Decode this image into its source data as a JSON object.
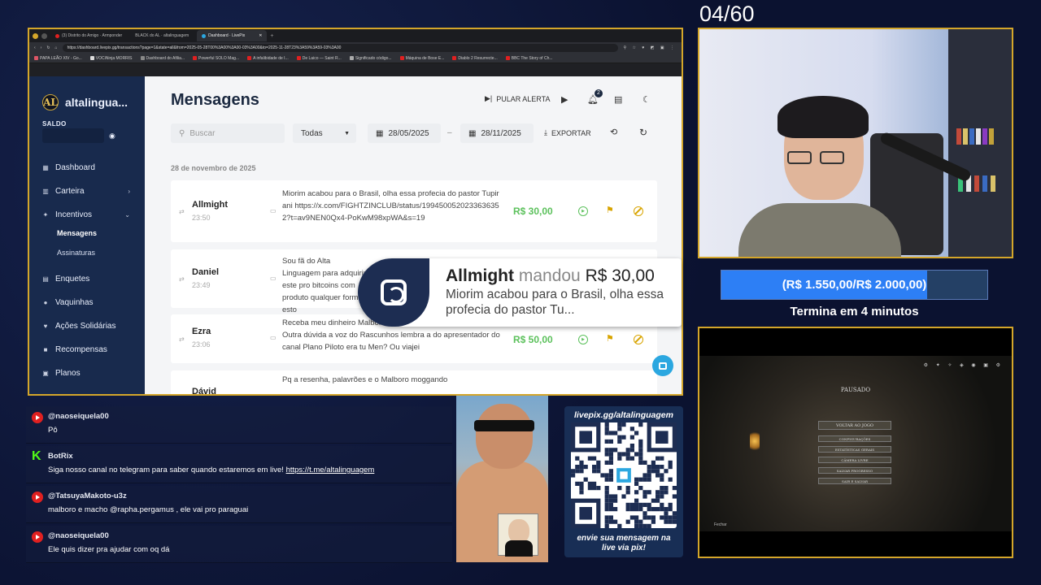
{
  "overlay": {
    "counter": "04/60",
    "goal_text": "(R$ 1.550,00/R$ 2.000,00)",
    "goal_progress": 0.775,
    "goal_ends": "Termina em 4 minutos",
    "qr_title": "livepix.gg/altalinguagem",
    "qr_footer_1": "envie sua mensagem na",
    "qr_footer_2": "live via pix!",
    "colors": {
      "frame": "#d4a62a",
      "goal_fill": "#2d7ff5",
      "bg": "#0b1230"
    }
  },
  "browser": {
    "tabs": [
      "(3) Distrito do Amigo · Armponder",
      "BLACK do AL · altalinguagem",
      "Dashboard · LivePix"
    ],
    "url": "https://dashboard.livepix.gg/transactions?page=1&state=all&from=2025-05-28T00%3A00%3A00-03%3A00&to=2025-11-28T23%3A59%3A59-03%3A00",
    "bookmarks": [
      "PAPA LEÃO XIV - Go...",
      "VOCiNinja MORRIS",
      "Dashboard do Afilia...",
      "Powerful SOLO Mag...",
      "A infalibidade de I...",
      "De Laico — Saint R...",
      "Significado código...",
      "Máquina de Bose E...",
      "Diablo 2 Resurrecte...",
      "BBC The Story of Ch..."
    ]
  },
  "sidebar": {
    "brand": "altalingua...",
    "logo": "AL",
    "saldo_label": "SALDO",
    "items": [
      {
        "label": "Dashboard",
        "icon": "dashboard-icon"
      },
      {
        "label": "Carteira",
        "icon": "wallet-icon"
      },
      {
        "label": "Incentivos",
        "icon": "sparkle-icon"
      },
      {
        "label": "Enquetes",
        "icon": "poll-icon"
      },
      {
        "label": "Vaquinhas",
        "icon": "piggy-icon"
      },
      {
        "label": "Ações Solidárias",
        "icon": "heart-icon"
      },
      {
        "label": "Recompensas",
        "icon": "gift-icon"
      },
      {
        "label": "Planos",
        "icon": "plans-icon"
      }
    ],
    "sub_items": [
      "Mensagens",
      "Assinaturas"
    ]
  },
  "main": {
    "title": "Mensagens",
    "skip_alert": "PULAR ALERTA",
    "notif_count": "2",
    "search_placeholder": "Buscar",
    "filter": "Todas",
    "date_from": "28/05/2025",
    "date_sep": "–",
    "date_to": "28/11/2025",
    "export": "EXPORTAR",
    "date_header": "28 de novembro de 2025",
    "rows": [
      {
        "name": "Allmight",
        "time": "23:50",
        "message": "Miorim acabou para o Brasil, olha essa profecia do pastor Tupirani https://x.com/FIGHTZINCLUB/status/1994500520233636352?t=av9NEN0Qx4-PoKwM98xpWA&s=19",
        "amount": "R$ 30,00"
      },
      {
        "name": "Daniel",
        "time": "23:49",
        "message": "Sou fã do Alta Linguagem para adquirir este pro bitcoins com produto qualquer forma, esto",
        "amount": ""
      },
      {
        "name": "Ezra",
        "time": "23:06",
        "message": "Receba meu dinheiro Malboro. O jantar de ontem foi gostoso? Outra dúvida a voz do Rascunhos lembra a do apresentador do canal Plano Piloto era tu Men? Ou viajei",
        "amount": "R$ 50,00"
      },
      {
        "name": "Dávid",
        "time": "",
        "message": "Pq a resenha, palavrões e o Malboro moggando",
        "amount": ""
      }
    ]
  },
  "alert": {
    "name": "Allmight",
    "verb": "mandou",
    "amount": "R$ 30,00",
    "message": "Miorim acabou para o Brasil, olha essa profecia do pastor Tu..."
  },
  "chat": [
    {
      "platform": "youtube",
      "user": "@naoseiquela00",
      "text": "Pô"
    },
    {
      "platform": "kick",
      "user": "BotRix",
      "text": "Siga nosso canal no telegram para saber quando estaremos em live!",
      "link": "https://t.me/altalinguagem"
    },
    {
      "platform": "youtube",
      "user": "@TatsuyaMakoto-u3z",
      "text": "malboro e macho @rapha.pergamus , ele vai pro paraguai"
    },
    {
      "platform": "youtube",
      "user": "@naoseiquela00",
      "text": "Ele quis dizer pra ajudar com oq dá"
    }
  ],
  "game": {
    "paused": "PAUSADO",
    "menu": [
      "VOLTAR AO JOGO",
      "CONFIGURAÇÕES",
      "ESTATÍSTICAS GERAIS",
      "CÂMERA LIVRE",
      "SALVAR PROGRESSO",
      "SAIR E SALVAR"
    ],
    "footer": "Fechar"
  }
}
